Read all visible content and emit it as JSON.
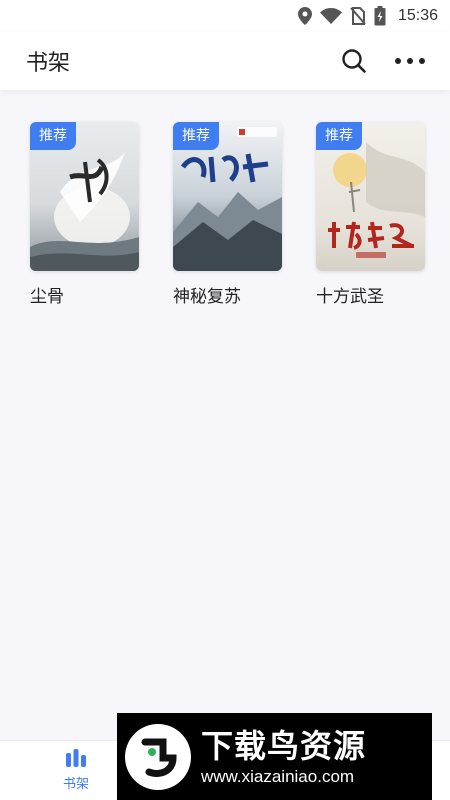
{
  "status_bar": {
    "time": "15:36",
    "icons": [
      "location-icon",
      "wifi-icon",
      "no-sim-icon",
      "battery-charging-icon"
    ]
  },
  "header": {
    "title": "书架",
    "actions": [
      "search-icon",
      "more-icon"
    ]
  },
  "books": [
    {
      "title": "尘骨",
      "tag": "推荐",
      "cover_theme": "misty-white-dragon"
    },
    {
      "title": "神秘复苏",
      "tag": "推荐",
      "cover_theme": "blue-snowy-mountain"
    },
    {
      "title": "十方武圣",
      "tag": "推荐",
      "cover_theme": "pale-sun-landscape"
    }
  ],
  "bottom_nav": {
    "items": [
      {
        "label": "书架",
        "icon": "bookshelf-icon",
        "active": true
      }
    ]
  },
  "watermark": {
    "title": "下载鸟资源",
    "url": "www.xiazainiao.com"
  },
  "colors": {
    "accent": "#3f7df1",
    "background": "#f7f7fb",
    "header_bg": "#ffffff"
  }
}
